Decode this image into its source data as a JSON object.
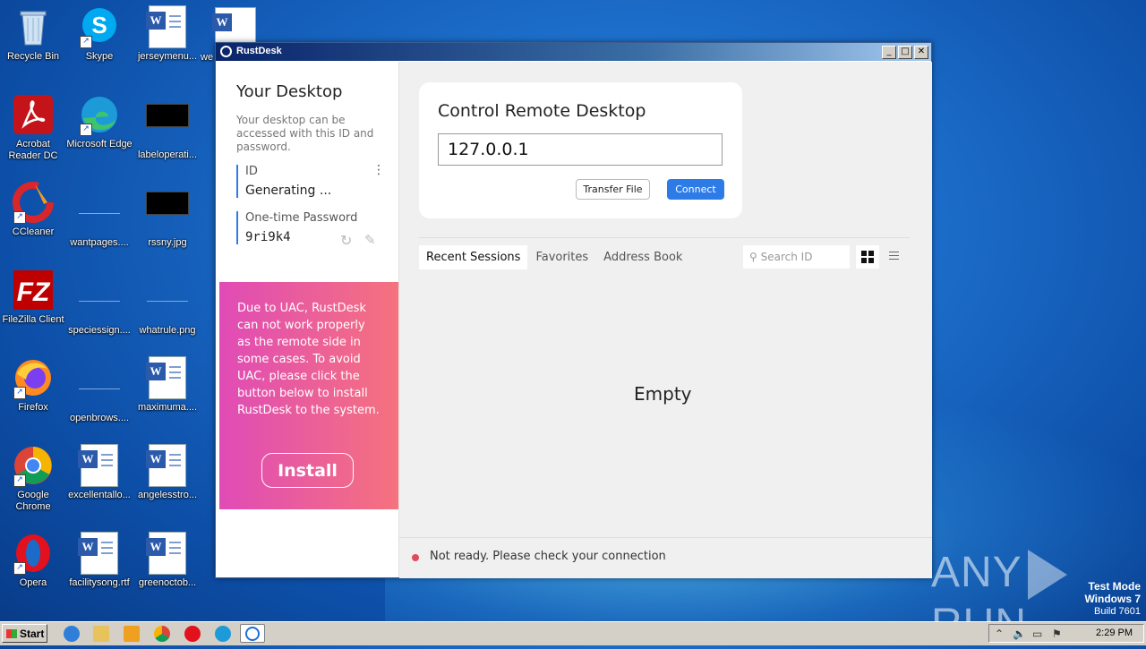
{
  "desktop": {
    "icons": [
      {
        "label": "Recycle Bin"
      },
      {
        "label": "Skype"
      },
      {
        "label": "jerseymenu..."
      },
      {
        "label": "we"
      },
      {
        "label": "Acrobat Reader DC"
      },
      {
        "label": "Microsoft Edge"
      },
      {
        "label": "labeloperati..."
      },
      {
        "label": "CCleaner"
      },
      {
        "label": "wantpages...."
      },
      {
        "label": "rssny.jpg"
      },
      {
        "label": "FileZilla Client"
      },
      {
        "label": "speciessign...."
      },
      {
        "label": "whatrule.png"
      },
      {
        "label": "Firefox"
      },
      {
        "label": "openbrows...."
      },
      {
        "label": "maximuma...."
      },
      {
        "label": "Google Chrome"
      },
      {
        "label": "excellentallo..."
      },
      {
        "label": "angelesstro..."
      },
      {
        "label": "Opera"
      },
      {
        "label": "facilitysong.rtf"
      },
      {
        "label": "greenoctob..."
      }
    ]
  },
  "window": {
    "title": "RustDesk",
    "controls": {
      "minimize": "_",
      "maximize": "□",
      "close": "✕"
    }
  },
  "left_panel": {
    "heading": "Your Desktop",
    "description": "Your desktop can be accessed with this ID and password.",
    "id_label": "ID",
    "id_value": "Generating ...",
    "otp_label": "One-time Password",
    "otp_value": "9ri9k4",
    "uac_message": "Due to UAC, RustDesk can not work properly as the remote side in some cases. To avoid UAC, please click the button below to install RustDesk to the system.",
    "install_label": "Install"
  },
  "control_card": {
    "heading": "Control Remote Desktop",
    "id_input_value": "127.0.0.1",
    "transfer_file_label": "Transfer File",
    "connect_label": "Connect"
  },
  "sessions": {
    "tabs": [
      {
        "label": "Recent Sessions",
        "active": true
      },
      {
        "label": "Favorites",
        "active": false
      },
      {
        "label": "Address Book",
        "active": false
      }
    ],
    "search_placeholder": "Search ID",
    "empty_text": "Empty"
  },
  "status_bar": {
    "text": "Not ready. Please check your connection",
    "status_color": "#e04a5a"
  },
  "watermark": {
    "left": "ANY",
    "right": "RUN"
  },
  "system_mode": {
    "line1": "Test Mode",
    "line2": "Windows 7",
    "line3": "Build 7601"
  },
  "taskbar": {
    "start_label": "Start",
    "clock": "2:29 PM"
  },
  "colors": {
    "accent": "#2d7be6",
    "uac_gradient_start": "#e04bb6",
    "uac_gradient_end": "#f5727e"
  }
}
